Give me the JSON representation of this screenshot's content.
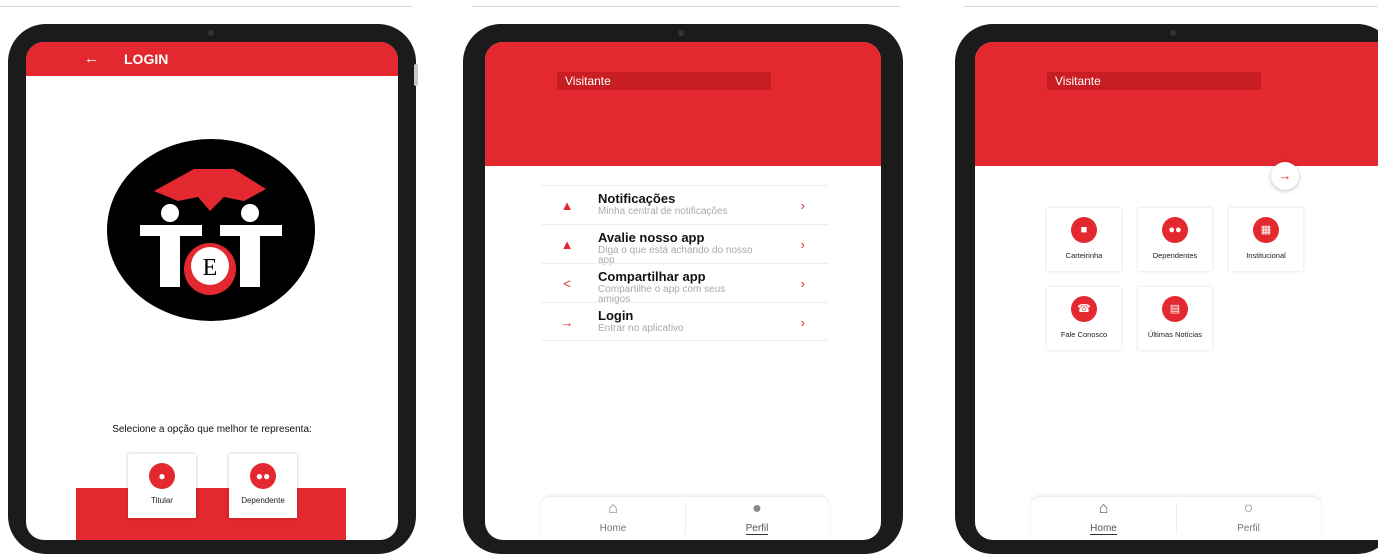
{
  "screen1": {
    "back_icon": "arrow-left-icon",
    "title": "LOGIN",
    "logo_letter": "E",
    "prompt": "Selecione a opção que melhor te representa:",
    "options": [
      {
        "label": "Titular",
        "icon": "person-icon"
      },
      {
        "label": "Dependente",
        "icon": "people-icon"
      }
    ]
  },
  "screen2": {
    "visitor": "Visitante",
    "menu": [
      {
        "title": "Notificações",
        "subtitle": "Minha central de notificações",
        "icon": "bell-icon"
      },
      {
        "title": "Avalie nosso app",
        "subtitle": "Diga o que está achando do nosso app",
        "icon": "thumbs-up-icon"
      },
      {
        "title": "Compartilhar app",
        "subtitle": "Compartilhe o app com seus amigos",
        "icon": "share-icon"
      },
      {
        "title": "Login",
        "subtitle": "Entrar no aplicativo",
        "icon": "login-icon"
      }
    ],
    "nav": [
      {
        "label": "Home",
        "icon": "home-icon",
        "active": false
      },
      {
        "label": "Perfil",
        "icon": "person-icon",
        "active": true
      }
    ]
  },
  "screen3": {
    "visitor": "Visitante",
    "exit_icon": "login-icon",
    "tiles": [
      {
        "label": "Carteirinha",
        "icon": "card-icon"
      },
      {
        "label": "Dependentes",
        "icon": "people-icon"
      },
      {
        "label": "Institucional",
        "icon": "building-icon"
      },
      {
        "label": "Fale Conosco",
        "icon": "phone-icon"
      },
      {
        "label": "Últimas Notícias",
        "icon": "news-icon"
      }
    ],
    "nav": [
      {
        "label": "Home",
        "icon": "home-icon",
        "active": true
      },
      {
        "label": "Perfil",
        "icon": "person-icon",
        "active": false
      }
    ]
  },
  "colors": {
    "accent": "#e3282f",
    "tablet_frame": "#1b1b1b"
  }
}
